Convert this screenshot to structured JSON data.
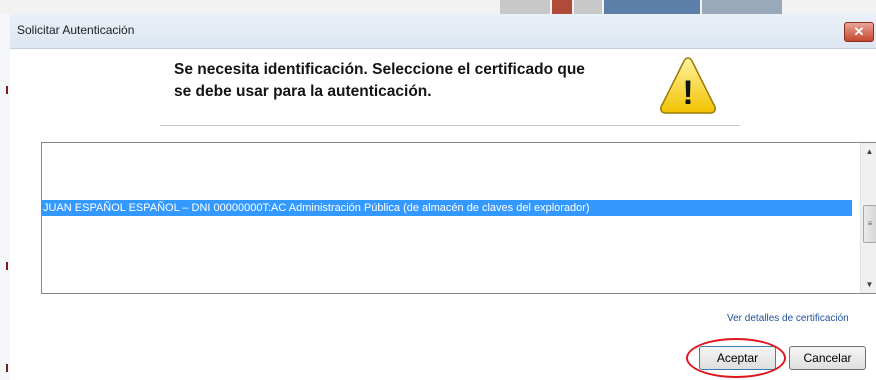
{
  "window": {
    "title": "Solicitar Autenticación",
    "close_glyph": "✕"
  },
  "header": {
    "line1": "Se necesita identificación. Seleccione el certificado que",
    "line2": "se debe usar para la autenticación.",
    "icon": "warning-icon",
    "icon_glyph": "!"
  },
  "certificate_list": {
    "items": [
      {
        "label": "JUAN ESPAÑOL ESPAÑOL – DNI 00000000T:AC Administración Pública (de almacén de claves del explorador)",
        "selected": true
      }
    ],
    "scrollbar": {
      "up_glyph": "▲",
      "down_glyph": "▼",
      "thumb_glyph": "≡"
    }
  },
  "links": {
    "details": "Ver detalles de certificación"
  },
  "buttons": {
    "accept": "Aceptar",
    "cancel": "Cancelar"
  },
  "colors": {
    "selection": "#3399ff",
    "highlight_ellipse": "#e0141e",
    "link": "#1f4e9c",
    "warning_fill": "#ffd700"
  }
}
